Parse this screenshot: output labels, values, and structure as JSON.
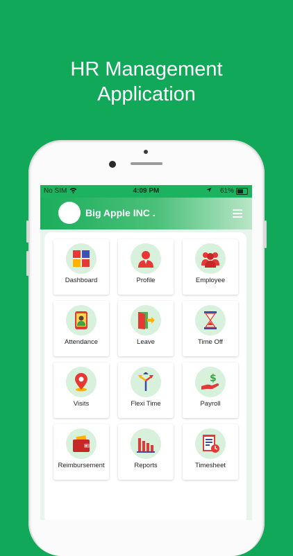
{
  "headline": {
    "line1": "HR Management",
    "line2": "Application"
  },
  "status_bar": {
    "carrier": "No SIM",
    "time": "4:09 PM",
    "battery": "61%"
  },
  "app_bar": {
    "company": "Big Apple INC ."
  },
  "menu_items": [
    {
      "label": "Dashboard",
      "icon": "dashboard-icon"
    },
    {
      "label": "Profile",
      "icon": "profile-icon"
    },
    {
      "label": "Employee",
      "icon": "employee-icon"
    },
    {
      "label": "Attendance",
      "icon": "attendance-icon"
    },
    {
      "label": "Leave",
      "icon": "leave-icon"
    },
    {
      "label": "Time Off",
      "icon": "hourglass-icon"
    },
    {
      "label": "Visits",
      "icon": "location-pin-icon"
    },
    {
      "label": "Flexi Time",
      "icon": "direction-arrows-icon"
    },
    {
      "label": "Payroll",
      "icon": "payroll-icon"
    },
    {
      "label": "Reimbursement",
      "icon": "wallet-icon"
    },
    {
      "label": "Reports",
      "icon": "bar-chart-icon"
    },
    {
      "label": "Timesheet",
      "icon": "timesheet-icon"
    }
  ],
  "colors": {
    "background": "#12a85a",
    "accent": "#1db25f",
    "icon_circle": "#d7f1dc"
  }
}
